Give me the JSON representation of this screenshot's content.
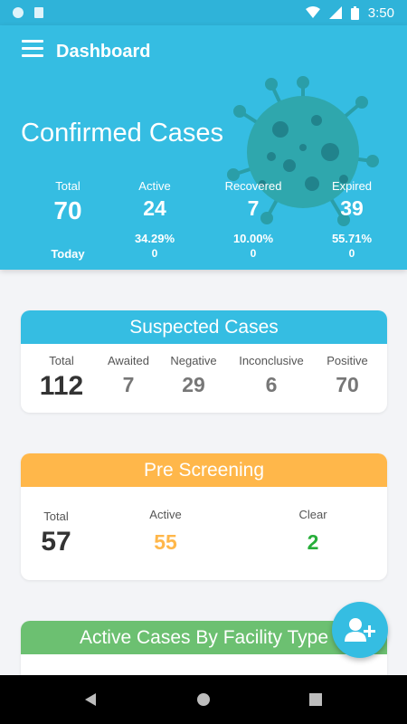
{
  "status": {
    "time": "3:50"
  },
  "header": {
    "title": "Dashboard",
    "hero_title": "Confirmed Cases",
    "today_label": "Today",
    "stats": [
      {
        "label": "Total",
        "value": "70"
      },
      {
        "label": "Active",
        "value": "24",
        "pct": "34.29%",
        "today": "0"
      },
      {
        "label": "Recovered",
        "value": "7",
        "pct": "10.00%",
        "today": "0"
      },
      {
        "label": "Expired",
        "value": "39",
        "pct": "55.71%",
        "today": "0"
      }
    ]
  },
  "suspected": {
    "title": "Suspected Cases",
    "columns": [
      {
        "label": "Total",
        "value": "112"
      },
      {
        "label": "Awaited",
        "value": "7"
      },
      {
        "label": "Negative",
        "value": "29"
      },
      {
        "label": "Inconclusive",
        "value": "6"
      },
      {
        "label": "Positive",
        "value": "70"
      }
    ]
  },
  "prescreening": {
    "title": "Pre Screening",
    "columns": [
      {
        "label": "Total",
        "value": "57"
      },
      {
        "label": "Active",
        "value": "55"
      },
      {
        "label": "Clear",
        "value": "2"
      }
    ]
  },
  "facility": {
    "title": "Active Cases By Facility Type"
  },
  "colors": {
    "primary": "#35bde2",
    "orange": "#ffb74a",
    "green": "#6cc071",
    "clear_green": "#27ae3a"
  },
  "icons": {
    "menu": "menu-icon",
    "fab": "add-user-icon",
    "virus": "virus-icon"
  }
}
